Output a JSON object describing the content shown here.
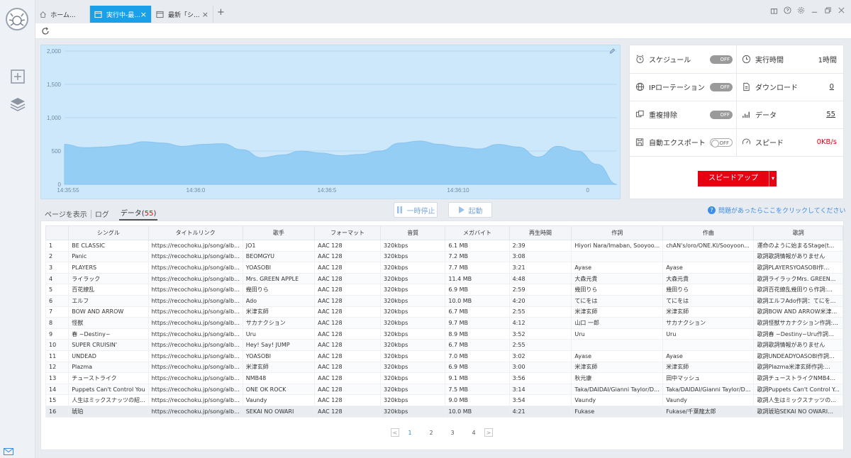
{
  "tabs": [
    {
      "label": "ホーム...",
      "icon": "home-icon"
    },
    {
      "label": "実行中-最...",
      "icon": "window-icon"
    },
    {
      "label": "最新「シ...",
      "icon": "window-icon"
    }
  ],
  "new_tab": "+",
  "chart_data": {
    "type": "area",
    "x_ticks": [
      "14:35:55",
      "14:36:0",
      "14:36:5",
      "14:36:10",
      "0"
    ],
    "y_ticks": [
      "2,000",
      "1,500",
      "1,000",
      "500",
      "0"
    ],
    "ylim": [
      0,
      2000
    ],
    "series": [
      {
        "values": [
          600,
          550,
          560,
          590,
          640,
          620,
          570,
          600,
          610,
          520,
          400,
          440,
          500,
          470,
          430,
          450,
          500,
          620,
          650,
          600,
          560,
          530,
          600,
          560,
          410,
          570,
          500,
          300,
          0
        ]
      }
    ]
  },
  "stats": {
    "schedule": {
      "label": "スケジュール",
      "toggle": "OFF"
    },
    "runtime": {
      "label": "実行時間",
      "value": "1時間"
    },
    "ip_rotation": {
      "label": "IPローテーション",
      "toggle": "OFF"
    },
    "download": {
      "label": "ダウンロード",
      "value": "0"
    },
    "dedupe": {
      "label": "重複排除",
      "toggle": "OFF"
    },
    "data": {
      "label": "データ",
      "value": "55"
    },
    "auto_export": {
      "label": "自動エクスポート",
      "toggle": "OFF"
    },
    "speed": {
      "label": "スピード",
      "value": "0KB/s"
    },
    "speedup_label": "スピードアップ"
  },
  "view": {
    "page_label": "ページを表示",
    "log_label": "ログ",
    "data_label": "データ(",
    "data_count": "55",
    "data_close": ")"
  },
  "controls": {
    "pause": "一時停止",
    "start": "起動"
  },
  "help_text": "問題があったらここをクリックしてください",
  "table": {
    "columns": [
      "",
      "シングル",
      "タイトルリンク",
      "歌手",
      "フォーマット",
      "音質",
      "メガバイト",
      "再生時間",
      "作詞",
      "作曲",
      "歌詞"
    ],
    "rows": [
      [
        "1",
        "BE CLASSIC",
        "https://recochoku.jp/song/alb...",
        "JO1",
        "AAC 128",
        "320kbps",
        "6.1 MB",
        "2:39",
        "Hiyori Nara/Imaban, Sooyoo...",
        "chAN's/oro/ONE.Kl/Sooyoon...",
        "運命のように始まるStage(t..."
      ],
      [
        "2",
        "Panic",
        "https://recochoku.jp/song/alb...",
        "BEOMGYU",
        "AAC 128",
        "320kbps",
        "7.2 MB",
        "3:08",
        "",
        "",
        "歌詞歌詞情報がありません"
      ],
      [
        "3",
        "PLAYERS",
        "https://recochoku.jp/song/alb...",
        "YOASOBI",
        "AAC 128",
        "320kbps",
        "7.7 MB",
        "3:21",
        "Ayase",
        "Ayase",
        "歌詞PLAYERSYOASOBI作..."
      ],
      [
        "4",
        "ライラック",
        "https://recochoku.jp/song/alb...",
        "Mrs. GREEN APPLE",
        "AAC 128",
        "320kbps",
        "11.4 MB",
        "4:48",
        "大森元貴",
        "大森元貴",
        "歌詞ライラックMrs. GREEN..."
      ],
      [
        "5",
        "百花繚乱",
        "https://recochoku.jp/song/alb...",
        "幾田りら",
        "AAC 128",
        "320kbps",
        "6.9 MB",
        "2:59",
        "幾田りら",
        "幾田りら",
        "歌詞百花繚乱幾田りら作詞:..."
      ],
      [
        "6",
        "エルフ",
        "https://recochoku.jp/song/alb...",
        "Ado",
        "AAC 128",
        "320kbps",
        "10.0 MB",
        "4:20",
        "てにをは",
        "てにをは",
        "歌詞エルフAdo作詞：てにを..."
      ],
      [
        "7",
        "BOW AND ARROW",
        "https://recochoku.jp/song/alb...",
        "米津玄師",
        "AAC 128",
        "320kbps",
        "6.7 MB",
        "2:55",
        "米津玄師",
        "米津玄師",
        "歌詞BOW AND ARROW米津..."
      ],
      [
        "8",
        "怪獣",
        "https://recochoku.jp/song/alb...",
        "サカナクション",
        "AAC 128",
        "320kbps",
        "9.7 MB",
        "4:12",
        "山口 一郎",
        "サカナクション",
        "歌詞怪獣サカナクション作詞:..."
      ],
      [
        "9",
        "春 ~Destiny~",
        "https://recochoku.jp/song/alb...",
        "Uru",
        "AAC 128",
        "320kbps",
        "8.9 MB",
        "3:52",
        "Uru",
        "Uru",
        "歌詞春 ~Destiny~Uru作詞..."
      ],
      [
        "10",
        "SUPER CRUISIN'",
        "https://recochoku.jp/song/alb...",
        "Hey! Say! JUMP",
        "AAC 128",
        "320kbps",
        "6.7 MB",
        "2:55",
        "",
        "",
        "歌詞歌詞情報がありません"
      ],
      [
        "11",
        "UNDEAD",
        "https://recochoku.jp/song/alb...",
        "YOASOBI",
        "AAC 128",
        "320kbps",
        "7.0 MB",
        "3:02",
        "Ayase",
        "Ayase",
        "歌詞UNDEADYOASOBI作詞..."
      ],
      [
        "12",
        "Plazma",
        "https://recochoku.jp/song/alb...",
        "米津玄師",
        "AAC 128",
        "320kbps",
        "6.9 MB",
        "3:00",
        "米津玄師",
        "米津玄師",
        "歌詞Plazma米津玄師作詞:..."
      ],
      [
        "13",
        "チューストライク",
        "https://recochoku.jp/song/alb...",
        "NMB48",
        "AAC 128",
        "320kbps",
        "9.1 MB",
        "3:56",
        "秋元康",
        "田中マッシュ",
        "歌詞チューストライクNMB4..."
      ],
      [
        "14",
        "Puppets Can't Control You",
        "https://recochoku.jp/song/alb...",
        "ONE OK ROCK",
        "AAC 128",
        "320kbps",
        "7.5 MB",
        "3:14",
        "Taka/DAIDAI/Gianni Taylor/D...",
        "Taka/DAIDAI/Gianni Taylor/D...",
        "歌詞Puppets Can't Control Y..."
      ],
      [
        "15",
        "人生はミックスナッツの紹...",
        "https://recochoku.jp/song/alb...",
        "Vaundy",
        "AAC 128",
        "320kbps",
        "9.0 MB",
        "3:54",
        "Vaundy",
        "Vaundy",
        "歌詞人生はミックスナッツの..."
      ],
      [
        "16",
        "琥珀",
        "https://recochoku.jp/song/alb...",
        "SEKAI NO OWARI",
        "AAC 128",
        "320kbps",
        "10.0 MB",
        "4:21",
        "Fukase",
        "Fukase/千葉龍太郎",
        "歌詞琥珀SEKAI NO OWARI..."
      ]
    ]
  },
  "pagination": {
    "pages": [
      "1",
      "2",
      "3",
      "4"
    ],
    "current": "1",
    "prev": "<",
    "next": ">"
  },
  "colors": {
    "accent": "#1aa0e8",
    "danger": "#e60012",
    "chart_fill": "#8ccaf4",
    "chart_bg": "#cde8fb"
  }
}
